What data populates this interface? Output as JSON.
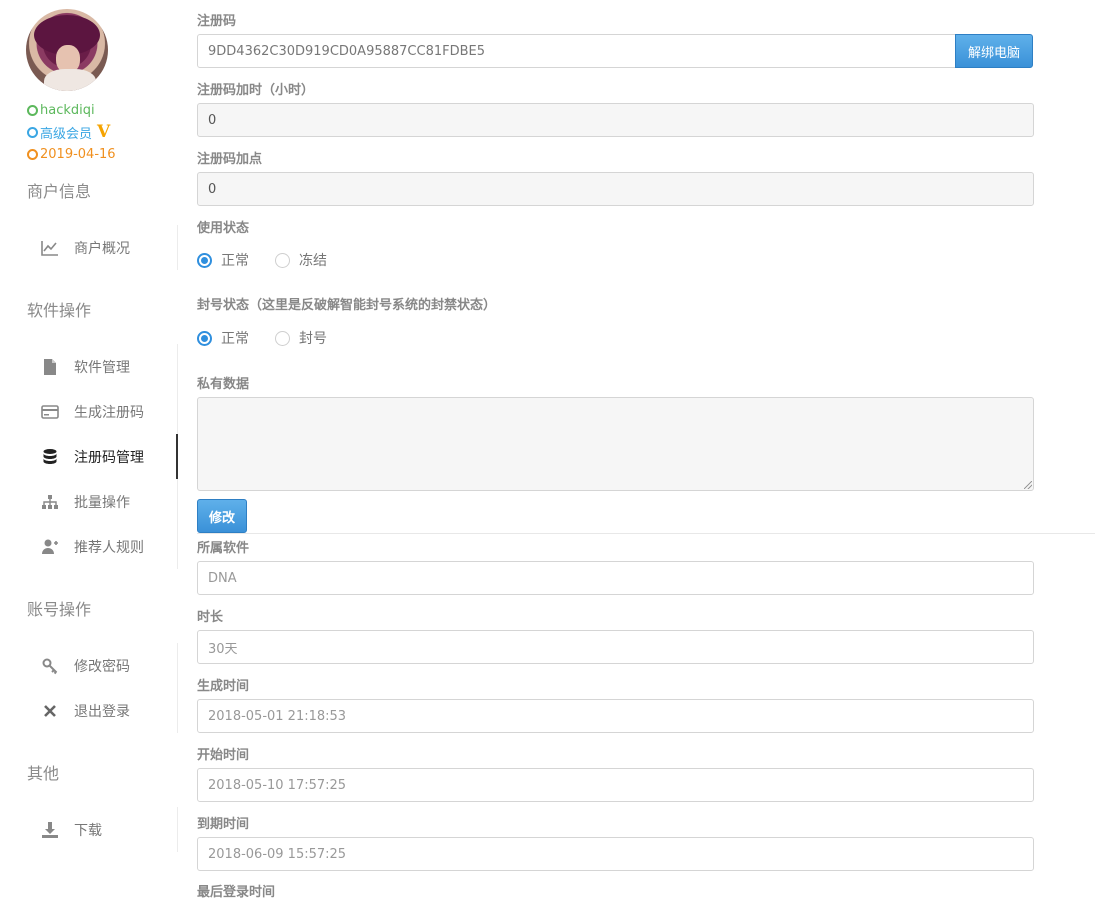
{
  "user": {
    "name": "hackdiqi",
    "level": "高级会员",
    "vip_badge": "V",
    "date": "2019-04-16"
  },
  "sidebar": {
    "sections": [
      {
        "title": "商户信息",
        "items": [
          {
            "label": "商户概况",
            "icon": "chart-line-icon"
          }
        ]
      },
      {
        "title": "软件操作",
        "items": [
          {
            "label": "软件管理",
            "icon": "file-icon"
          },
          {
            "label": "生成注册码",
            "icon": "credit-card-icon"
          },
          {
            "label": "注册码管理",
            "icon": "database-icon",
            "active": true
          },
          {
            "label": "批量操作",
            "icon": "sitemap-icon"
          },
          {
            "label": "推荐人规则",
            "icon": "user-plus-icon"
          }
        ]
      },
      {
        "title": "账号操作",
        "items": [
          {
            "label": "修改密码",
            "icon": "key-icon"
          },
          {
            "label": "退出登录",
            "icon": "close-icon"
          }
        ]
      },
      {
        "title": "其他",
        "items": [
          {
            "label": "下载",
            "icon": "download-icon"
          }
        ]
      }
    ]
  },
  "form": {
    "regcode": {
      "label": "注册码",
      "value": "9DD4362C30D919CD0A95887CC81FDBE5",
      "unbind_label": "解绑电脑"
    },
    "add_hours": {
      "label": "注册码加时（小时）",
      "value": "0"
    },
    "add_points": {
      "label": "注册码加点",
      "value": "0"
    },
    "use_status": {
      "label": "使用状态",
      "options": [
        "正常",
        "冻结"
      ],
      "selected": "正常"
    },
    "ban_status": {
      "label": "封号状态（这里是反破解智能封号系统的封禁状态）",
      "options": [
        "正常",
        "封号"
      ],
      "selected": "正常"
    },
    "private_data": {
      "label": "私有数据",
      "value": ""
    },
    "submit_label": "修改"
  },
  "info": {
    "software": {
      "label": "所属软件",
      "value": "DNA"
    },
    "duration": {
      "label": "时长",
      "value": "30天"
    },
    "created": {
      "label": "生成时间",
      "value": "2018-05-01 21:18:53"
    },
    "start": {
      "label": "开始时间",
      "value": "2018-05-10 17:57:25"
    },
    "expire": {
      "label": "到期时间",
      "value": "2018-06-09 15:57:25"
    },
    "last_login": {
      "label": "最后登录时间"
    }
  },
  "colors": {
    "accent": "#3a91d8",
    "user_name": "#5cb85c",
    "user_level": "#3aa6e3",
    "user_date": "#f0901f",
    "vip": "#f5a300"
  }
}
